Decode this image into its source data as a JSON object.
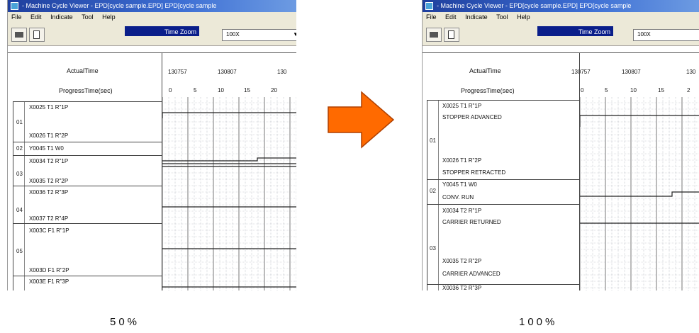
{
  "left_window": {
    "title": "- Machine Cycle Viewer - EPD[cycle sample.EPD]  EPD[cycle sample",
    "menu": [
      "File",
      "Edit",
      "Indicate",
      "Tool",
      "Help"
    ],
    "zoom_label": "Time Zoom",
    "zoom_value": "100X",
    "header": {
      "actual_time_label": "ActualTime",
      "progress_label": "ProgressTime(sec)"
    },
    "time_ticks": [
      "130757",
      "130807",
      "130"
    ],
    "progress_ticks": [
      "0",
      "5",
      "10",
      "15",
      "20"
    ],
    "rows": [
      {
        "num": "01",
        "signals": [
          "X0025 T1 R\"1P",
          "X0026 T1 R\"2P"
        ]
      },
      {
        "num": "02",
        "signals": [
          "Y0045 T1 W0"
        ]
      },
      {
        "num": "03",
        "signals": [
          "X0034 T2 R\"1P",
          "X0035 T2 R\"2P"
        ]
      },
      {
        "num": "04",
        "signals": [
          "X0036 T2 R\"3P",
          "X0037 T2 R\"4P"
        ]
      },
      {
        "num": "05",
        "signals": [
          "X003C F1 R\"1P",
          "X003D F1 R\"2P"
        ]
      },
      {
        "num": "",
        "signals": [
          "X003E F1 R\"3P"
        ]
      }
    ]
  },
  "right_window": {
    "title": "- Machine Cycle Viewer - EPD[cycle sample.EPD]  EPD[cycle sample",
    "menu": [
      "File",
      "Edit",
      "Indicate",
      "Tool",
      "Help"
    ],
    "zoom_label": "Time Zoom",
    "zoom_value": "100X",
    "header": {
      "actual_time_label": "ActualTime",
      "progress_label": "ProgressTime(sec)"
    },
    "time_ticks": [
      "130757",
      "130807",
      "130"
    ],
    "progress_ticks": [
      "0",
      "5",
      "10",
      "15",
      "2"
    ],
    "rows": [
      {
        "num": "01",
        "signals": [
          "X0025 T1 R\"1P",
          "STOPPER ADVANCED",
          "X0026 T1 R\"2P",
          "STOPPER RETRACTED"
        ]
      },
      {
        "num": "02",
        "signals": [
          "Y0045 T1 W0",
          "CONV. RUN"
        ]
      },
      {
        "num": "03",
        "signals": [
          "X0034 T2 R\"1P",
          "CARRIER RETURNED",
          "X0035 T2 R\"2P",
          "CARRIER ADVANCED"
        ]
      },
      {
        "num": "",
        "signals": [
          "X0036 T2 R\"3P"
        ]
      }
    ]
  },
  "captions": {
    "left": "50%",
    "right": "100%"
  },
  "colors": {
    "arrow": "#ff6a00",
    "arrow_border": "#b04000",
    "title_bar": "#1f3f9e",
    "zoom_label_bg": "#0a1e8a"
  }
}
